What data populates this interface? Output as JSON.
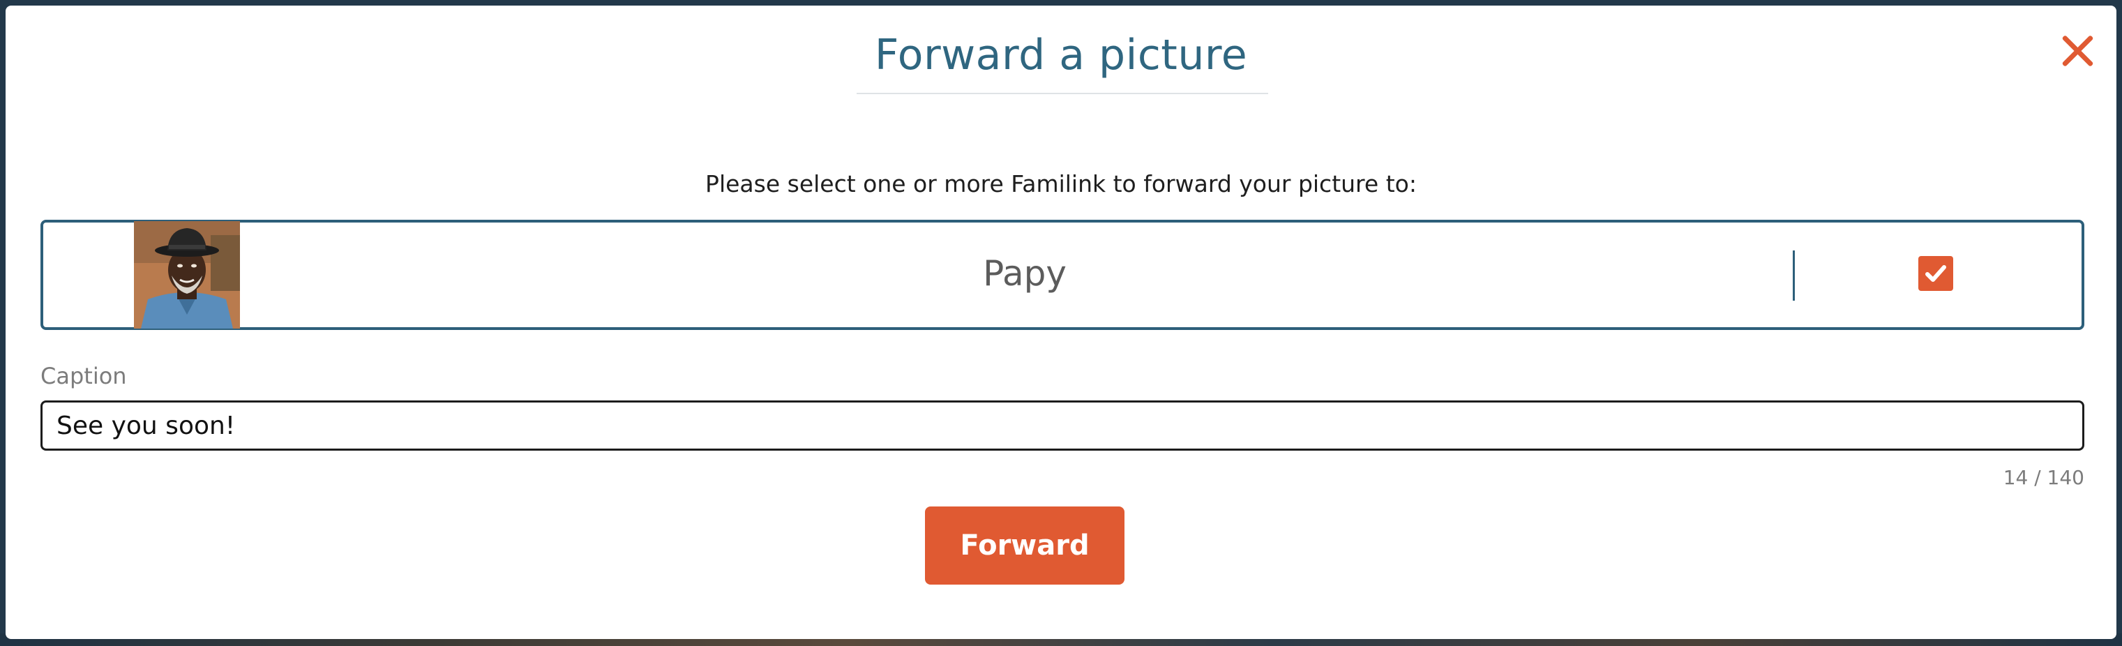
{
  "modal": {
    "title": "Forward a picture",
    "instruction": "Please select one or more Familink to forward your picture to:",
    "close_icon": "close-icon"
  },
  "familinks": [
    {
      "name": "Papy",
      "avatar_icon": "avatar",
      "selected": true
    }
  ],
  "caption": {
    "label": "Caption",
    "value": "See you soon!",
    "counter": "14 / 140"
  },
  "actions": {
    "forward_label": "Forward"
  },
  "colors": {
    "accent": "#e05a32",
    "title": "#2f6680",
    "row_border": "#2d5f7a"
  }
}
